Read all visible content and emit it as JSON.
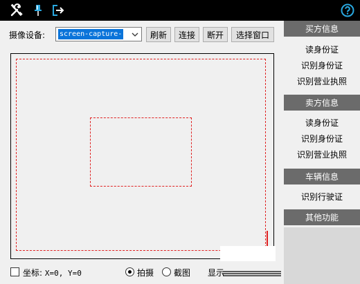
{
  "toolbar": {
    "icons": [
      "tools-icon",
      "pin-icon",
      "exit-icon",
      "help-icon"
    ]
  },
  "device": {
    "label": "摄像设备:",
    "selected": "screen-capture-",
    "buttons": {
      "refresh": "刷新",
      "connect": "连接",
      "disconnect": "断开",
      "select_window": "选择窗口"
    }
  },
  "bottom": {
    "coord_label": "坐标:",
    "coord_value": "X=0, Y=0",
    "capture_mode_label": "拍摄",
    "screenshot_mode_label": "截图",
    "display_label": "显示",
    "selected_mode": "capture"
  },
  "sidebar": {
    "sections": [
      {
        "title": "买方信息",
        "items": [
          "读身份证",
          "识别身份证",
          "识别营业执照"
        ]
      },
      {
        "title": "卖方信息",
        "items": [
          "读身份证",
          "识别身份证",
          "识别营业执照"
        ]
      },
      {
        "title": "车辆信息",
        "items": [
          "识别行驶证"
        ]
      },
      {
        "title": "其他功能",
        "items": []
      }
    ]
  },
  "colors": {
    "topbar": "#000000",
    "section_header": "#6b6b6b",
    "selection": "#0a74da",
    "dashed_frame": "#e02020",
    "help_icon": "#29a8e0",
    "icon_white": "#ffffff"
  }
}
